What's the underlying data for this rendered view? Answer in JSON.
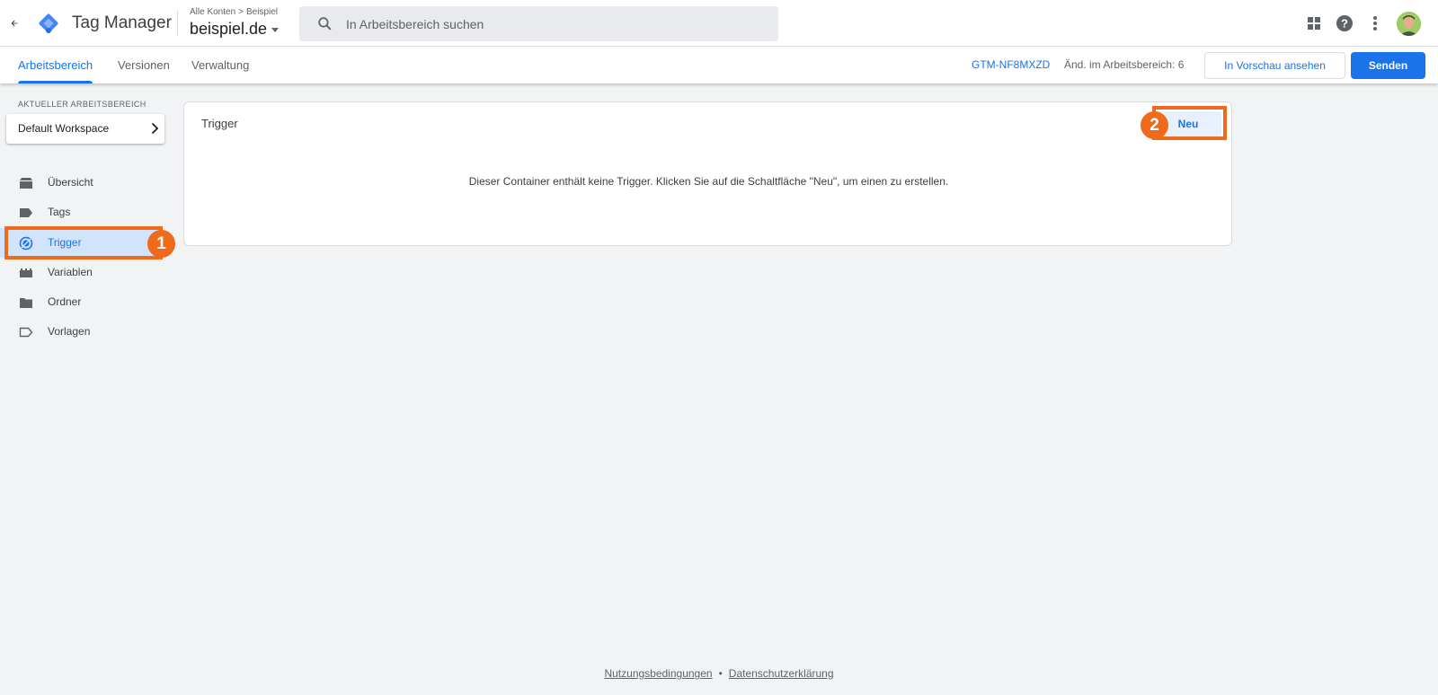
{
  "header": {
    "app_title": "Tag Manager",
    "breadcrumb": {
      "account": "Alle Konten",
      "separator": ">",
      "current": "Beispiel"
    },
    "container_name": "beispiel.de",
    "search_placeholder": "In Arbeitsbereich suchen",
    "icons": [
      "back-arrow-icon",
      "tag-manager-logo",
      "search-icon",
      "apps-grid-icon",
      "help-icon",
      "more-vert-icon"
    ]
  },
  "subnav": {
    "tabs": [
      {
        "label": "Arbeitsbereich",
        "active": true
      },
      {
        "label": "Versionen",
        "active": false
      },
      {
        "label": "Verwaltung",
        "active": false
      }
    ],
    "container_id": "GTM-NF8MXZD",
    "workspace_changes": "Änd. im Arbeitsbereich: 6",
    "preview_label": "In Vorschau ansehen",
    "send_label": "Senden"
  },
  "sidebar": {
    "workspace_label": "AKTUELLER ARBEITSBEREICH",
    "workspace_name": "Default Workspace",
    "items": [
      {
        "label": "Übersicht",
        "icon": "overview-icon",
        "active": false
      },
      {
        "label": "Tags",
        "icon": "tag-icon",
        "active": false
      },
      {
        "label": "Trigger",
        "icon": "trigger-icon",
        "active": true
      },
      {
        "label": "Variablen",
        "icon": "variables-icon",
        "active": false
      },
      {
        "label": "Ordner",
        "icon": "folder-icon",
        "active": false
      },
      {
        "label": "Vorlagen",
        "icon": "template-icon",
        "active": false
      }
    ]
  },
  "main": {
    "card_title": "Trigger",
    "new_button": "Neu",
    "empty_message": "Dieser Container enthält keine Trigger. Klicken Sie auf die Schaltfläche \"Neu\", um einen zu erstellen."
  },
  "annotations": {
    "step1": "1",
    "step2": "2"
  },
  "footer": {
    "terms": "Nutzungsbedingungen",
    "separator": "•",
    "privacy": "Datenschutzerklärung"
  },
  "colors": {
    "accent": "#1a73e8",
    "highlight": "#f06a1c",
    "active_bg": "#d2e3fc"
  }
}
